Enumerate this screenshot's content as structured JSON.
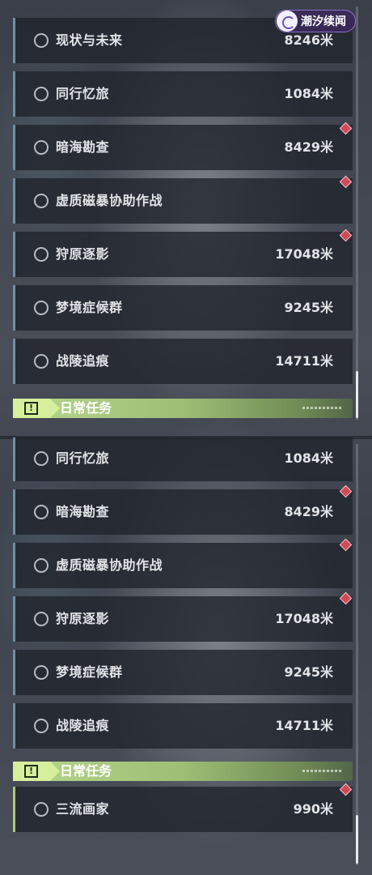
{
  "top_panel": {
    "badge": {
      "text": "潮汐续闻"
    },
    "items": [
      {
        "name": "现状与未来",
        "distance": "8246米"
      },
      {
        "name": "同行忆旅",
        "distance": "1084米"
      },
      {
        "name": "暗海勘查",
        "distance": "8429米"
      },
      {
        "name": "虚质磁暴协助作战",
        "distance": ""
      },
      {
        "name": "狩原逐影",
        "distance": "17048米"
      },
      {
        "name": "梦境症候群",
        "distance": "9245米"
      },
      {
        "name": "战陵追痕",
        "distance": "14711米"
      }
    ],
    "section_title": "日常任务"
  },
  "bottom_panel": {
    "items": [
      {
        "name": "同行忆旅",
        "distance": "1084米"
      },
      {
        "name": "暗海勘查",
        "distance": "8429米"
      },
      {
        "name": "虚质磁暴协助作战",
        "distance": ""
      },
      {
        "name": "狩原逐影",
        "distance": "17048米"
      },
      {
        "name": "梦境症候群",
        "distance": "9245米"
      },
      {
        "name": "战陵追痕",
        "distance": "14711米"
      }
    ],
    "section_title": "日常任务",
    "daily_items": [
      {
        "name": "三流画家",
        "distance": "990米"
      }
    ]
  },
  "colors": {
    "item_border": "#6f8fa4",
    "daily_border": "#a9c97a",
    "alert": "#d04a58",
    "section_green": "#b7d78e"
  },
  "icons": {
    "quest_status": "circle-outline-icon",
    "alert": "diamond-alert-icon",
    "section": "exclamation-box-icon"
  }
}
